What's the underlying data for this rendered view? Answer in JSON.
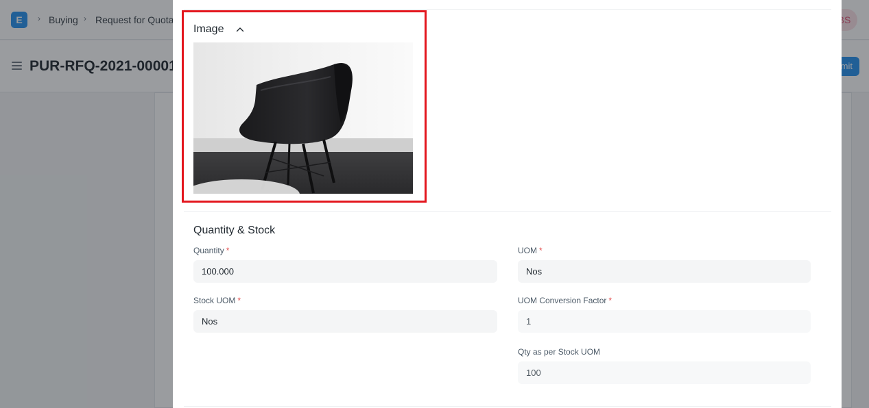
{
  "navbar": {
    "logo_letter": "E",
    "breadcrumbs": [
      "Buying",
      "Request for Quotation"
    ],
    "user_initials": "BS"
  },
  "page": {
    "title": "PUR-RFQ-2021-00001",
    "primary_action": "Submit"
  },
  "modal": {
    "image_section": {
      "title": "Image",
      "collapse_icon": "chevron-up-icon",
      "image_alt": "chair photo"
    },
    "quantity_section": {
      "title": "Quantity & Stock",
      "fields": {
        "quantity": {
          "label": "Quantity",
          "required": true,
          "value": "100.000"
        },
        "uom": {
          "label": "UOM",
          "required": true,
          "value": "Nos"
        },
        "stock_uom": {
          "label": "Stock UOM",
          "required": true,
          "value": "Nos"
        },
        "conversion_factor": {
          "label": "UOM Conversion Factor",
          "required": true,
          "value": "1"
        },
        "qty_stock_uom": {
          "label": "Qty as per Stock UOM",
          "required": false,
          "value": "100"
        }
      }
    }
  },
  "colors": {
    "primary": "#2490ef",
    "highlight": "#e3161d",
    "required_marker": "#e24c4c"
  }
}
